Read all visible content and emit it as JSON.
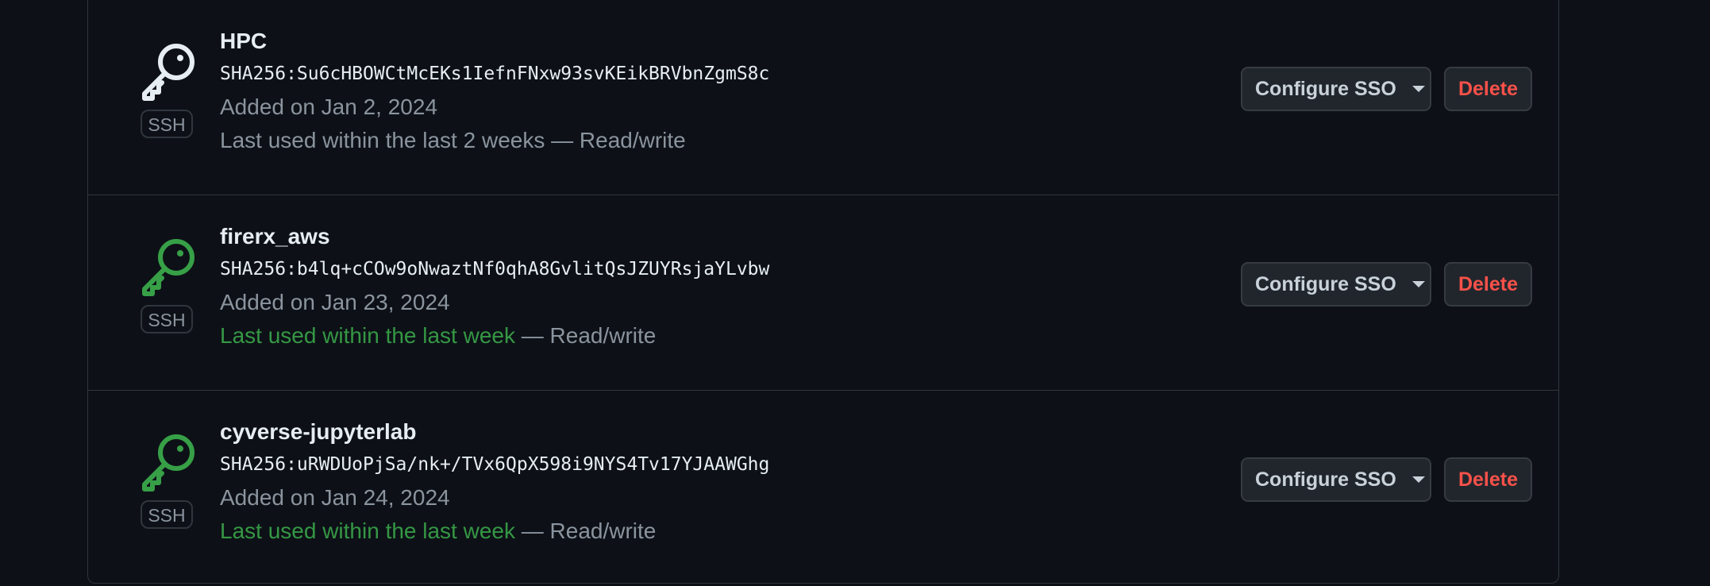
{
  "keys": [
    {
      "title": "HPC",
      "fingerprint": "SHA256:Su6cHBOWCtMcEKs1IefnFNxw93svKEikBRVbnZgmS8c",
      "added": "Added on Jan 2, 2024",
      "last_used": "Last used within the last 2 weeks",
      "last_used_recent": false,
      "access": " — Read/write",
      "type_badge": "SSH",
      "icon": "key-icon",
      "icon_color": "#e6edf3",
      "sso_label": "Configure SSO",
      "delete_label": "Delete"
    },
    {
      "title": "firerx_aws",
      "fingerprint": "SHA256:b4lq+cCOw9oNwaztNf0qhA8GvlitQsJZUYRsjaYLvbw",
      "added": "Added on Jan 23, 2024",
      "last_used": "Last used within the last week",
      "last_used_recent": true,
      "access": " — Read/write",
      "type_badge": "SSH",
      "icon": "key-icon",
      "icon_color": "#3fb950",
      "sso_label": "Configure SSO",
      "delete_label": "Delete"
    },
    {
      "title": "cyverse-jupyterlab",
      "fingerprint": "SHA256:uRWDUoPjSa/nk+/TVx6QpX598i9NYS4Tv17YJAAWGhg",
      "added": "Added on Jan 24, 2024",
      "last_used": "Last used within the last week",
      "last_used_recent": true,
      "access": " — Read/write",
      "type_badge": "SSH",
      "icon": "key-icon",
      "icon_color": "#3fb950",
      "sso_label": "Configure SSO",
      "delete_label": "Delete"
    }
  ],
  "colors": {
    "background": "#0d1117",
    "border": "#30363d",
    "recent_green": "#3fb950",
    "danger_red": "#f85149",
    "muted_text": "#8b949e"
  }
}
